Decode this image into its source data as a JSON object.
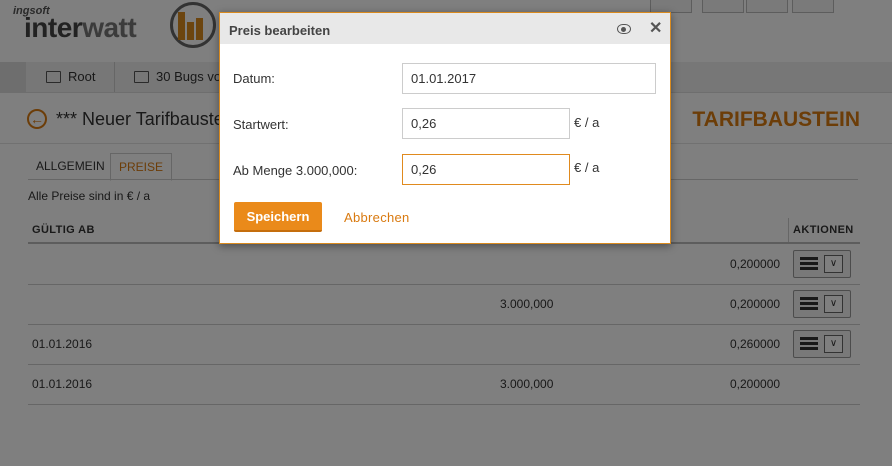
{
  "header": {
    "logo_small": "ingsoft",
    "logo_inter": "inter",
    "logo_watt": "watt"
  },
  "breadcrumb": {
    "items": [
      "Root",
      "30 Bugs vo"
    ]
  },
  "page": {
    "title": "*** Neuer Tarifbauste",
    "section": "TARIFBAUSTEIN",
    "tabs": [
      {
        "label": "ALLGEMEIN",
        "active": false
      },
      {
        "label": "PREISE",
        "active": true
      }
    ],
    "note": "Alle Preise sind in € / a"
  },
  "table": {
    "headers": {
      "col1": "GÜLTIG AB",
      "actions": "AKTIONEN"
    },
    "rows": [
      {
        "date": "",
        "menge": "",
        "value": "0,200000",
        "has_action": true
      },
      {
        "date": "",
        "menge": "3.000,000",
        "value": "0,200000",
        "has_action": true
      },
      {
        "date": "01.01.2016",
        "menge": "",
        "value": "0,260000",
        "has_action": true
      },
      {
        "date": "01.01.2016",
        "menge": "3.000,000",
        "value": "0,200000",
        "has_action": false
      }
    ]
  },
  "dialog": {
    "title": "Preis bearbeiten",
    "fields": {
      "datum": {
        "label": "Datum:",
        "value": "01.01.2017"
      },
      "startwert": {
        "label": "Startwert:",
        "value": "0,26",
        "unit": "€ / a"
      },
      "ab_menge": {
        "label": "Ab Menge 3.000,000:",
        "value": "0,26",
        "unit": "€ / a"
      }
    },
    "save_label": "Speichern",
    "cancel_label": "Abbrechen"
  },
  "colors": {
    "accent": "#ea8a1a",
    "accent_text": "#d97a10",
    "overlay": "rgba(0,0,0,0.5)"
  },
  "icons": [
    "folder-icon",
    "back-arrow-icon",
    "menu-icon",
    "chevron-down-icon",
    "eye-icon",
    "close-icon"
  ]
}
